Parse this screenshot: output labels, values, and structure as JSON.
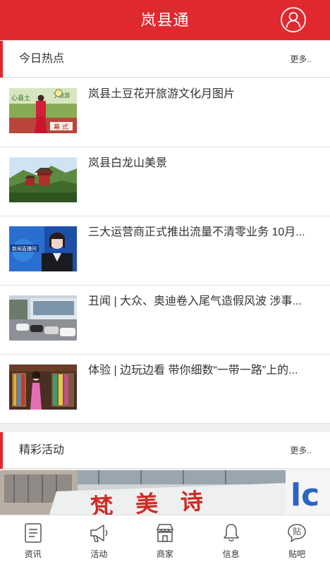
{
  "header": {
    "title": "岚县通",
    "accent_color": "#e0292e",
    "user_icon": "user-icon"
  },
  "hot_section": {
    "title": "今日热点",
    "more": "更多.."
  },
  "news": [
    {
      "headline": "岚县土豆花开旅游文化月图片",
      "thumb": "festival-stage-photo"
    },
    {
      "headline": "岚县白龙山美景",
      "thumb": "mountain-pavilion-photo"
    },
    {
      "headline": "三大运营商正式推出流量不清零业务 10月...",
      "thumb": "news-anchor-photo"
    },
    {
      "headline": "丑闻 | 大众、奥迪卷入尾气造假风波 涉事...",
      "thumb": "car-lot-photo"
    },
    {
      "headline": "体验 | 边玩边看 带你细数“一带一路”上的...",
      "thumb": "shop-woman-photo"
    }
  ],
  "activity_section": {
    "title": "精彩活动",
    "more": "更多.."
  },
  "banner": {
    "sign_text": "梵美诗"
  },
  "tabbar": {
    "items": [
      {
        "label": "资讯",
        "icon": "news-icon"
      },
      {
        "label": "活动",
        "icon": "megaphone-icon"
      },
      {
        "label": "商家",
        "icon": "shop-icon"
      },
      {
        "label": "信息",
        "icon": "bell-icon"
      },
      {
        "label": "贴吧",
        "icon": "forum-bubble-icon",
        "icon_text": "贴"
      }
    ]
  }
}
